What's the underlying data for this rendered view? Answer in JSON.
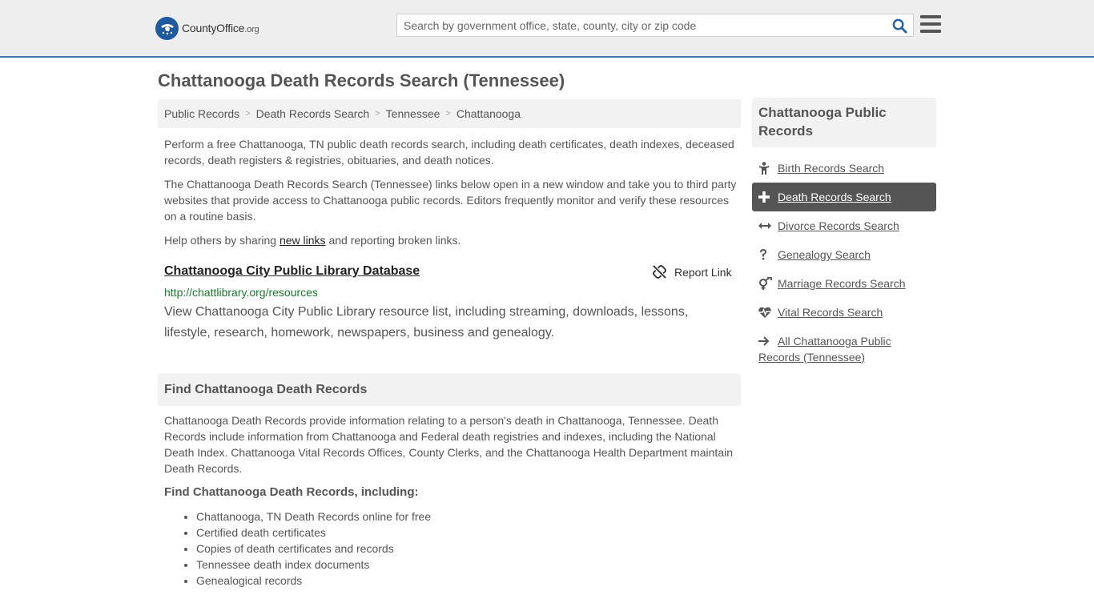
{
  "header": {
    "logo_main": "CountyOffice",
    "logo_tld": ".org",
    "search_placeholder": "Search by government office, state, county, city or zip code"
  },
  "page": {
    "title": "Chattanooga Death Records Search (Tennessee)"
  },
  "breadcrumb": [
    "Public Records",
    "Death Records Search",
    "Tennessee",
    "Chattanooga"
  ],
  "intro": {
    "p1": "Perform a free Chattanooga, TN public death records search, including death certificates, death indexes, deceased records, death registers & registries, obituaries, and death notices.",
    "p2": "The Chattanooga Death Records Search (Tennessee) links below open in a new window and take you to third party websites that provide access to Chattanooga public records. Editors frequently monitor and verify these resources on a routine basis.",
    "p3_before": "Help others by sharing ",
    "p3_link": "new links",
    "p3_after": " and reporting broken links."
  },
  "record": {
    "title": "Chattanooga City Public Library Database",
    "report_label": "Report Link",
    "url": "http://chattlibrary.org/resources",
    "description": "View Chattanooga City Public Library resource list, including streaming, downloads, lessons, lifestyle, research, homework, newspapers, business and genealogy."
  },
  "find": {
    "heading": "Find Chattanooga Death Records",
    "body": "Chattanooga Death Records provide information relating to a person's death in Chattanooga, Tennessee. Death Records include information from Chattanooga and Federal death registries and indexes, including the National Death Index. Chattanooga Vital Records Offices, County Clerks, and the Chattanooga Health Department maintain Death Records.",
    "subheading": "Find Chattanooga Death Records, including:",
    "items": [
      "Chattanooga, TN Death Records online for free",
      "Certified death certificates",
      "Copies of death certificates and records",
      "Tennessee death index documents",
      "Genealogical records"
    ]
  },
  "sidebar": {
    "heading": "Chattanooga Public Records",
    "items": [
      {
        "label": "Birth Records Search",
        "icon": "child-icon"
      },
      {
        "label": "Death Records Search",
        "icon": "plus-icon"
      },
      {
        "label": "Divorce Records Search",
        "icon": "arrows-horizontal-icon"
      },
      {
        "label": "Genealogy Search",
        "icon": "question-icon"
      },
      {
        "label": "Marriage Records Search",
        "icon": "venus-mars-icon"
      },
      {
        "label": "Vital Records Search",
        "icon": "heartbeat-icon"
      },
      {
        "label": "All Chattanooga Public Records (Tennessee)",
        "icon": "arrow-right-icon"
      }
    ],
    "active_index": 1
  },
  "colors": {
    "accent": "#3b73b9",
    "url_green": "#1a7a2f",
    "active_bg": "#555555",
    "panel_bg": "#f2f2f2"
  }
}
